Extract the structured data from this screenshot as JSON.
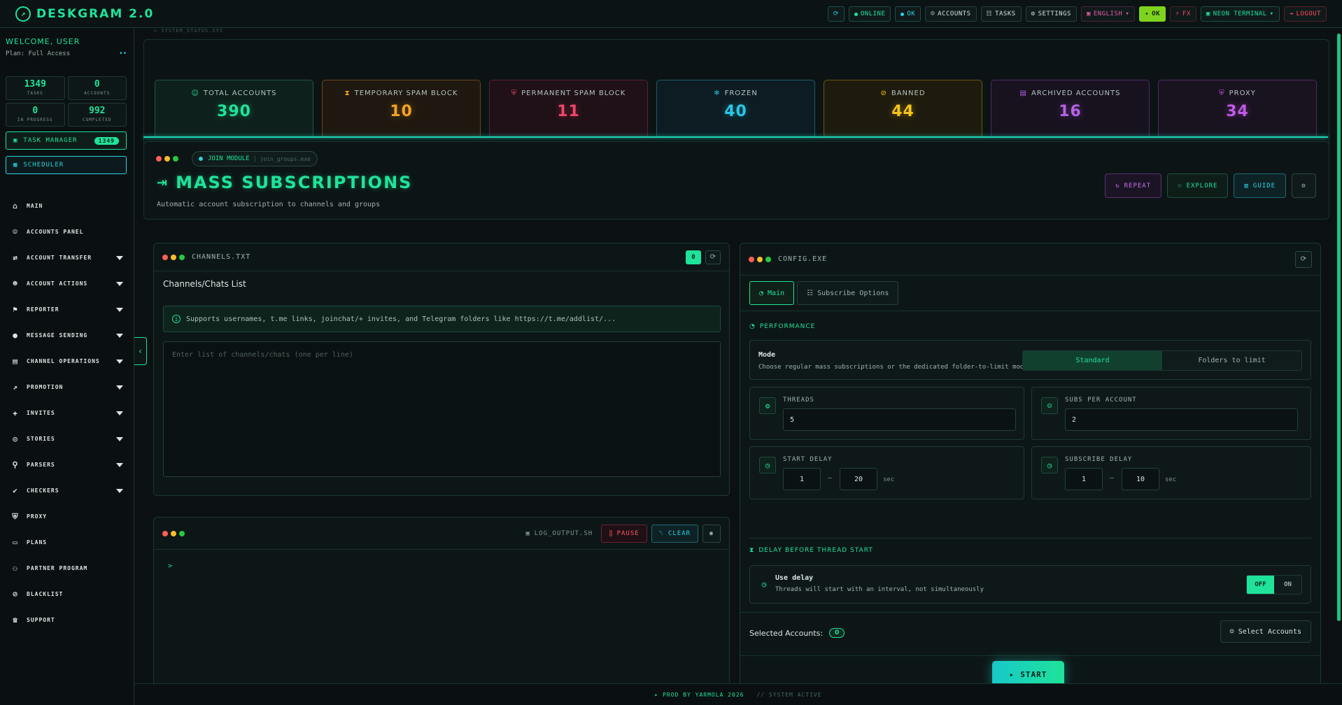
{
  "app": {
    "title": "DESKGRAM 2.0"
  },
  "topbar": {
    "online": "ONLINE",
    "ok_small": "OK",
    "accounts": "ACCOUNTS",
    "tasks": "TASKS",
    "settings": "SETTINGS",
    "language": "ENGLISH",
    "ok": "OK",
    "fx": "FX",
    "theme": "NEON TERMINAL",
    "logout": "LOGOUT"
  },
  "sidebar": {
    "welcome": "WELCOME, USER",
    "plan": "Plan: Full Access",
    "plan_link": "••",
    "stats": [
      {
        "value": "1349",
        "label": "TASKS"
      },
      {
        "value": "0",
        "label": "ACCOUNTS"
      },
      {
        "value": "0",
        "label": "IN PROGRESS"
      },
      {
        "value": "992",
        "label": "COMPLETED"
      }
    ],
    "task_manager": "TASK MANAGER",
    "task_manager_count": "1349",
    "scheduler": "SCHEDULER",
    "nav": [
      {
        "label": "MAIN",
        "icon": "home-icon",
        "caret": false
      },
      {
        "label": "ACCOUNTS PANEL",
        "icon": "users-icon",
        "caret": false
      },
      {
        "label": "ACCOUNT TRANSFER",
        "icon": "transfer-icon",
        "caret": true
      },
      {
        "label": "ACCOUNT ACTIONS",
        "icon": "user-actions-icon",
        "caret": true
      },
      {
        "label": "REPORTER",
        "icon": "flag-icon",
        "caret": true
      },
      {
        "label": "MESSAGE SENDING",
        "icon": "chat-icon",
        "caret": true
      },
      {
        "label": "CHANNEL OPERATIONS",
        "icon": "channel-icon",
        "caret": true
      },
      {
        "label": "PROMOTION",
        "icon": "chart-icon",
        "caret": true
      },
      {
        "label": "INVITES",
        "icon": "invite-icon",
        "caret": true
      },
      {
        "label": "STORIES",
        "icon": "stories-icon",
        "caret": true
      },
      {
        "label": "PARSERS",
        "icon": "search-icon",
        "caret": true
      },
      {
        "label": "CHECKERS",
        "icon": "check-icon",
        "caret": true
      },
      {
        "label": "PROXY",
        "icon": "shield-icon",
        "caret": false
      },
      {
        "label": "PLANS",
        "icon": "card-icon",
        "caret": false
      },
      {
        "label": "PARTNER PROGRAM",
        "icon": "partner-icon",
        "caret": false
      },
      {
        "label": "BLACKLIST",
        "icon": "block-user-icon",
        "caret": false
      },
      {
        "label": "SUPPORT",
        "icon": "headset-icon",
        "caret": false
      }
    ]
  },
  "main": {
    "sys_status": "> SYSTEM_STATUS.SYS",
    "stat_cards": [
      {
        "title": "TOTAL ACCOUNTS",
        "value": "390",
        "color": "#1fe39a",
        "border": "#1d5a46",
        "bg": "#0e201b",
        "icon": "users-icon",
        "glyph": "☺"
      },
      {
        "title": "TEMPORARY SPAM BLOCK",
        "value": "10",
        "color": "#f5a323",
        "border": "#6a4318",
        "bg": "#1f1810",
        "icon": "hourglass-icon",
        "glyph": "⧗"
      },
      {
        "title": "PERMANENT SPAM BLOCK",
        "value": "11",
        "color": "#f0456b",
        "border": "#5e1f33",
        "bg": "#1f1117",
        "icon": "shield-alert-icon",
        "glyph": "⛨"
      },
      {
        "title": "FROZEN",
        "value": "40",
        "color": "#27c8e8",
        "border": "#195a6a",
        "bg": "#0d1c22",
        "icon": "snowflake-icon",
        "glyph": "❄"
      },
      {
        "title": "BANNED",
        "value": "44",
        "color": "#f5c518",
        "border": "#6a5818",
        "bg": "#1e1b0e",
        "icon": "ban-icon",
        "glyph": "⊘"
      },
      {
        "title": "ARCHIVED ACCOUNTS",
        "value": "16",
        "color": "#b463e6",
        "border": "#4b2a66",
        "bg": "#18121f",
        "icon": "archive-icon",
        "glyph": "▤"
      },
      {
        "title": "PROXY",
        "value": "34",
        "color": "#c05ae8",
        "border": "#4f2a66",
        "bg": "#19121f",
        "icon": "shield-icon",
        "glyph": "⛨"
      }
    ],
    "module": {
      "name": "JOIN MODULE",
      "file": "join_groups.exe"
    },
    "title": "MASS SUBSCRIPTIONS",
    "subtitle": "Automatic account subscription to channels and groups",
    "actions": {
      "repeat": "REPEAT",
      "explore": "EXPLORE",
      "guide": "GUIDE"
    }
  },
  "channels": {
    "file": "CHANNELS.TXT",
    "count": "0",
    "title": "Channels/Chats List",
    "info": "Supports usernames, t.me links, joinchat/+ invites, and Telegram folders like https://t.me/addlist/...",
    "placeholder": "Enter list of channels/chats (one per line)"
  },
  "log": {
    "file": "LOG_OUTPUT.SH",
    "pause": "PAUSE",
    "clear": "CLEAR",
    "prompt": ">"
  },
  "config": {
    "file": "CONFIG.EXE",
    "tabs": [
      "Main",
      "Subscribe Options"
    ],
    "performance": "PERFORMANCE",
    "mode": {
      "label": "Mode",
      "desc": "Choose regular mass subscriptions or the dedicated folder-to-limit mode",
      "options": [
        "Standard",
        "Folders to limit"
      ],
      "selected": "Standard"
    },
    "threads": {
      "label": "THREADS",
      "value": "5"
    },
    "subs_per_account": {
      "label": "SUBS PER ACCOUNT",
      "value": "2"
    },
    "start_delay": {
      "label": "START DELAY",
      "min": "1",
      "max": "20",
      "unit": "sec"
    },
    "subscribe_delay": {
      "label": "SUBSCRIBE DELAY",
      "min": "1",
      "max": "10",
      "unit": "sec"
    },
    "delay_section": "DELAY BEFORE THREAD START",
    "use_delay": {
      "label": "Use delay",
      "desc": "Threads will start with an interval, not simultaneously",
      "off": "OFF",
      "on": "ON",
      "state": "OFF"
    },
    "selected_accounts_label": "Selected Accounts:",
    "selected_accounts": "0",
    "select_accounts": "Select Accounts",
    "start": "START"
  },
  "footer": {
    "credit": "▸ PROD BY YARMOLA 2026",
    "status": "// SYSTEM ACTIVE"
  }
}
